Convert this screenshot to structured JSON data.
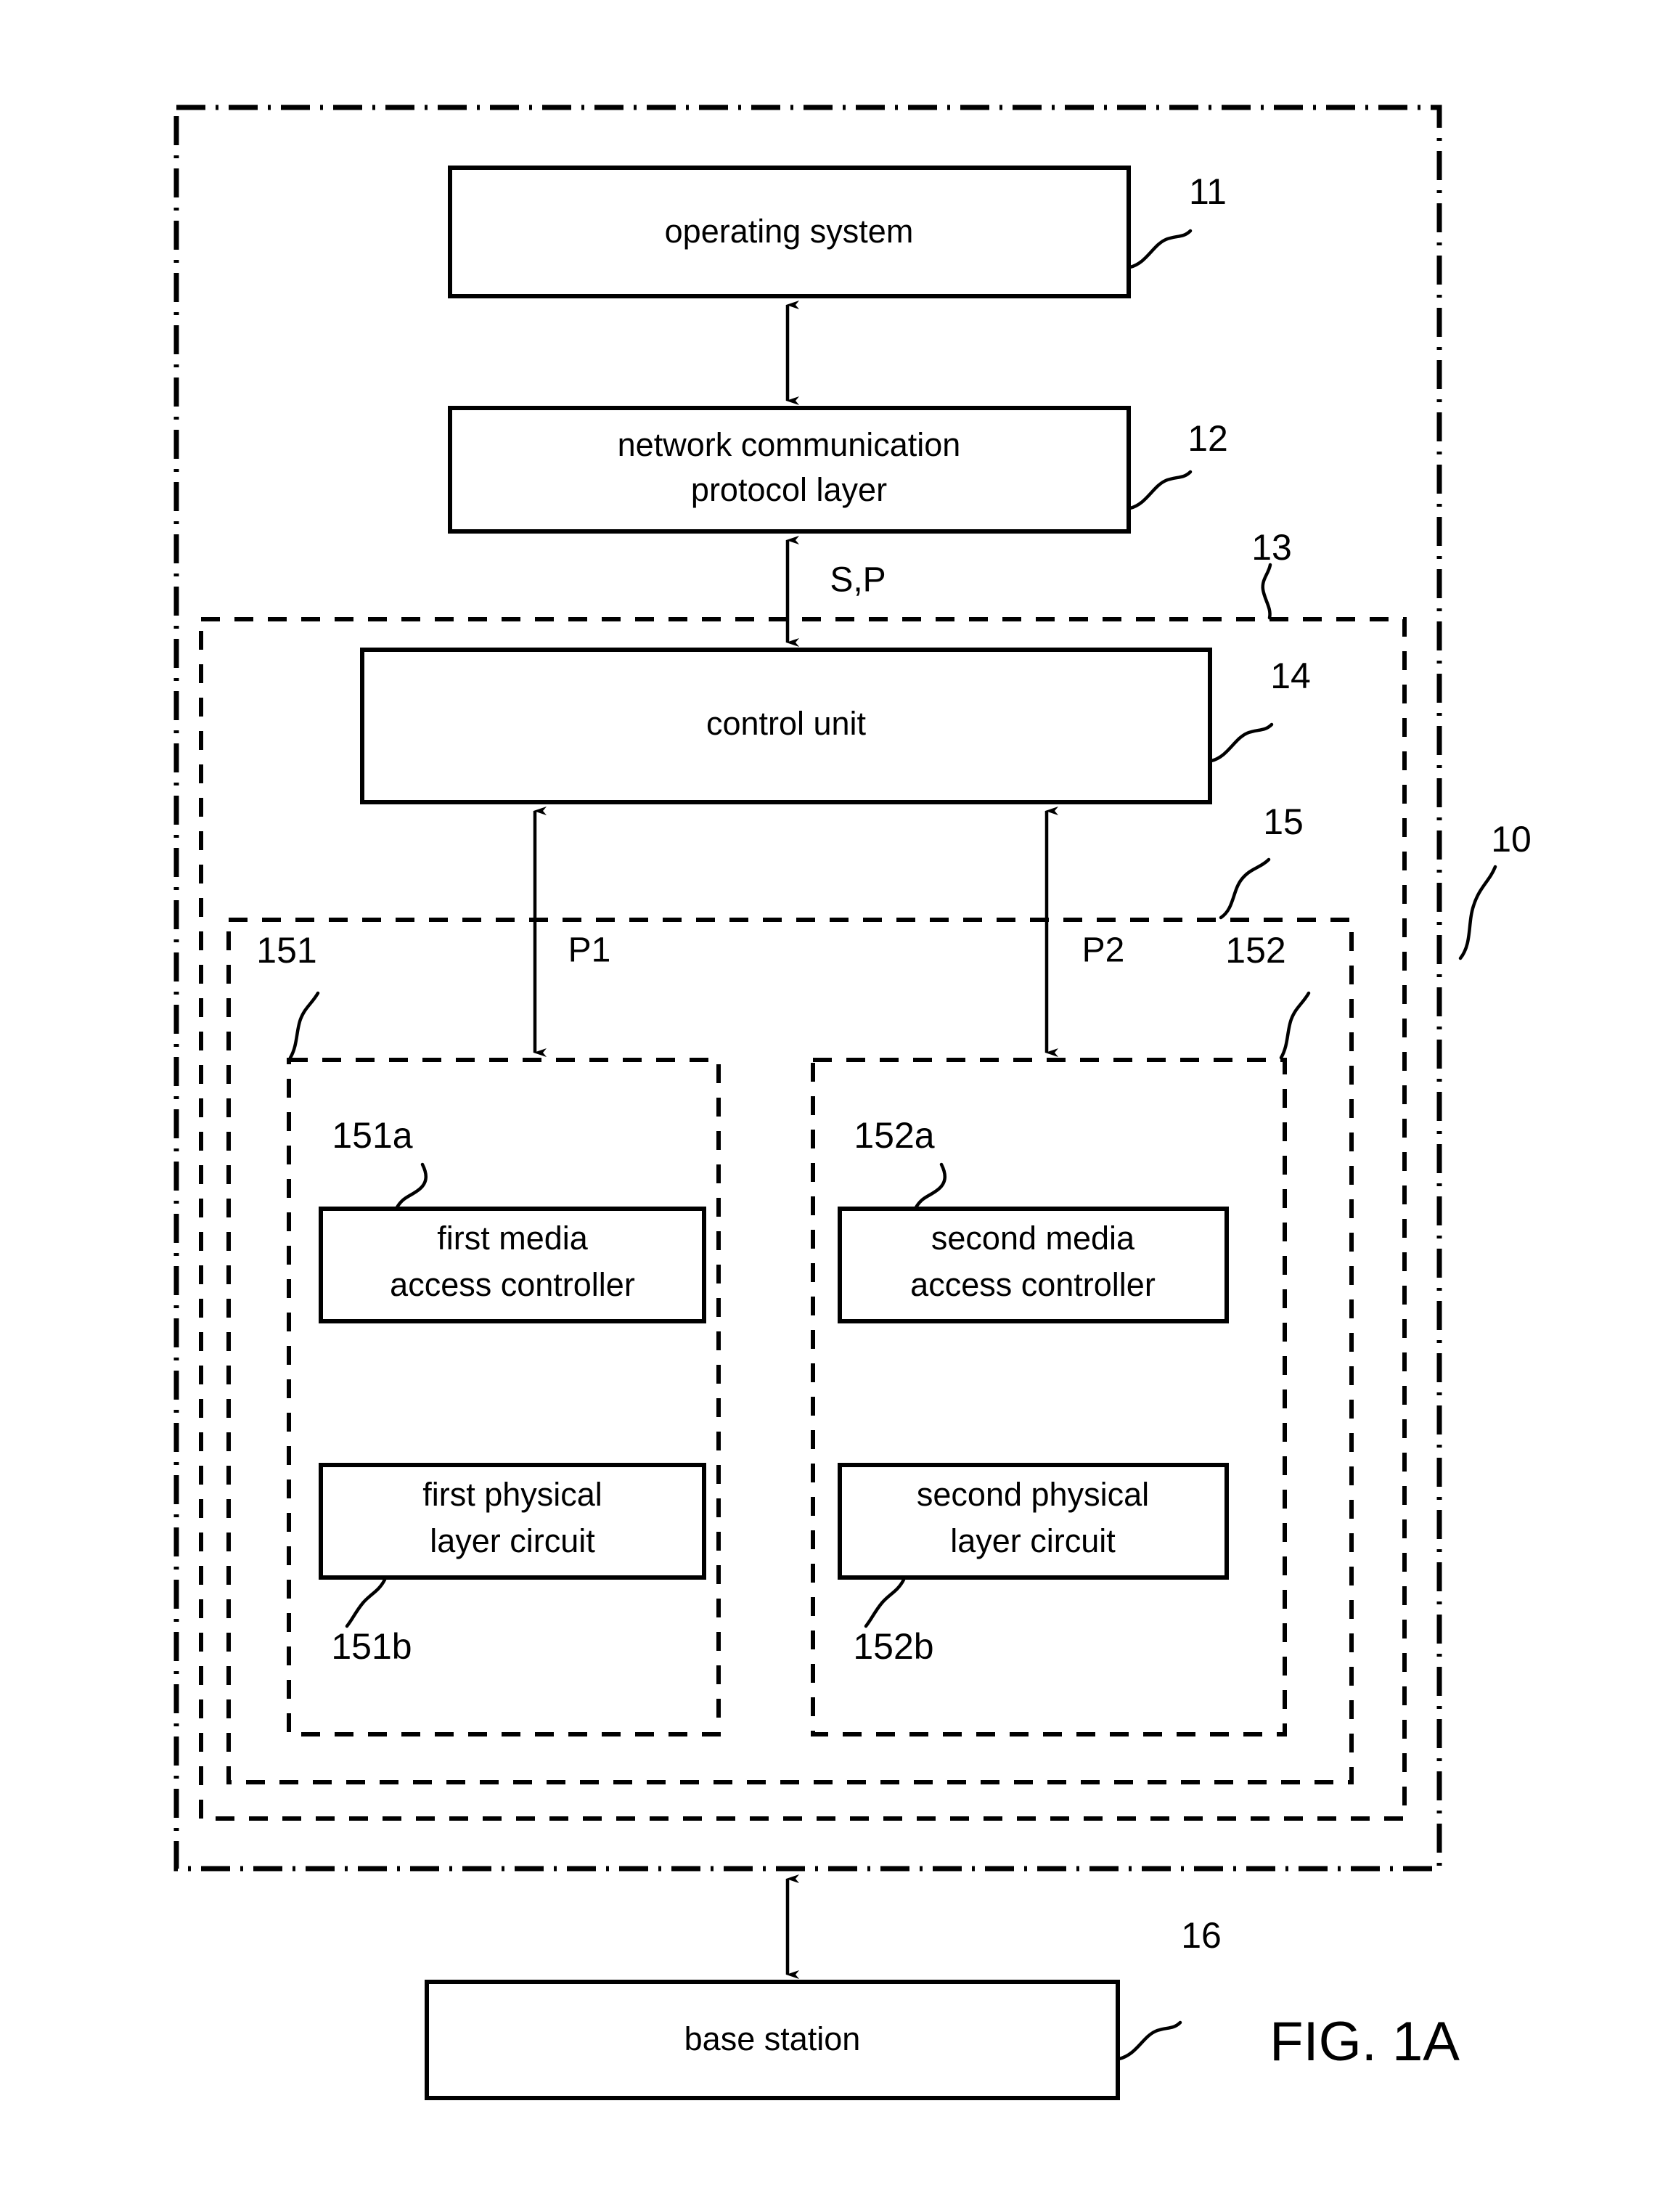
{
  "figure": {
    "caption": "FIG. 1A"
  },
  "blocks": {
    "operating_system": {
      "label": "operating system",
      "ref": "11"
    },
    "network_protocol": {
      "line1": "network communication",
      "line2": "protocol layer",
      "ref": "12"
    },
    "control_unit": {
      "label": "control unit",
      "ref": "14"
    },
    "first_mac": {
      "line1": "first media",
      "line2": "access controller",
      "ref": "151a"
    },
    "second_mac": {
      "line1": "second media",
      "line2": "access controller",
      "ref": "152a"
    },
    "first_phy": {
      "line1": "first physical",
      "line2": "layer circuit",
      "ref": "151b"
    },
    "second_phy": {
      "line1": "second physical",
      "line2": "layer circuit",
      "ref": "152b"
    },
    "base_station": {
      "label": "base station",
      "ref": "16"
    }
  },
  "containers": {
    "device": {
      "ref": "10"
    },
    "network_interface": {
      "ref": "13"
    },
    "transceiver_group": {
      "ref": "15"
    },
    "first_transceiver": {
      "ref": "151"
    },
    "second_transceiver": {
      "ref": "152"
    }
  },
  "signals": {
    "sp": "S,P",
    "p1": "P1",
    "p2": "P2"
  },
  "colors": {
    "line": "#000000",
    "background": "#ffffff"
  }
}
